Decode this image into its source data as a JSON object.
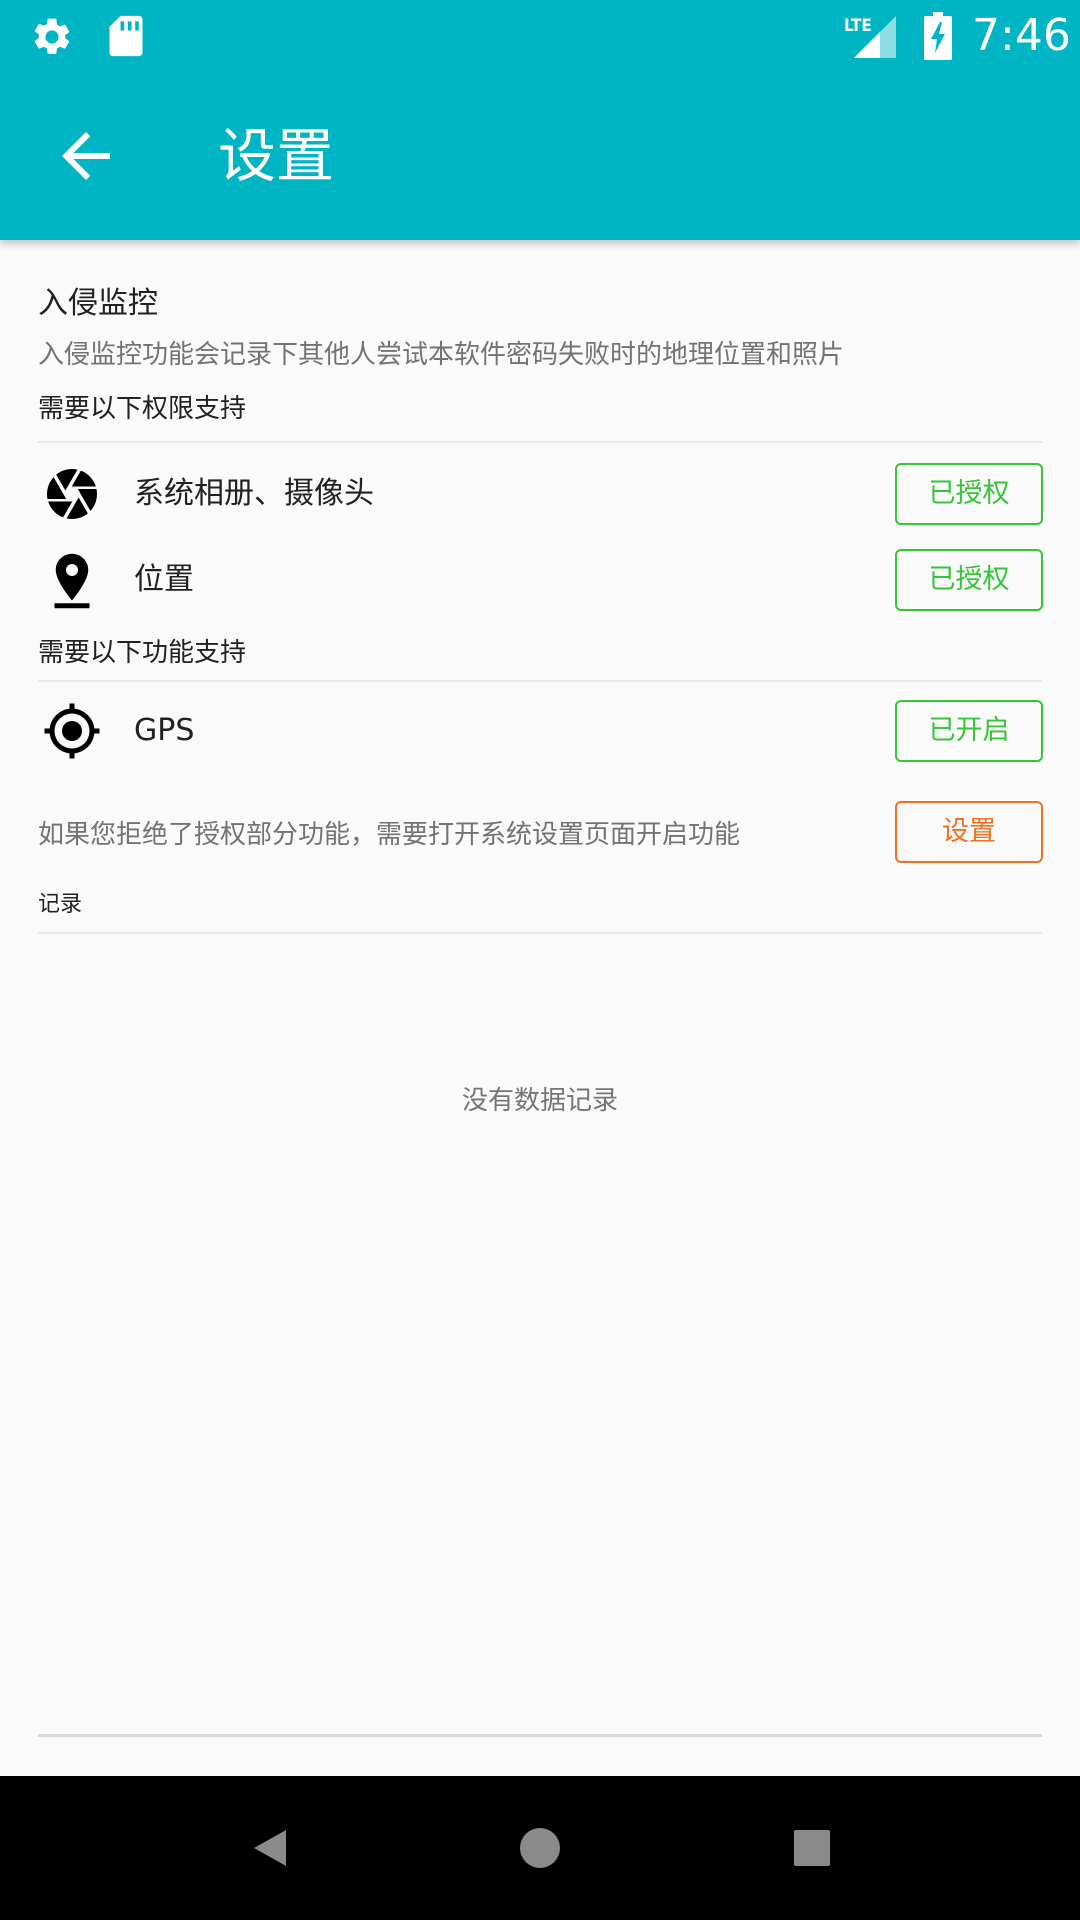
{
  "status_bar": {
    "time": "7:46",
    "network_label": "LTE",
    "icons": [
      "gear-icon",
      "sd-card-icon",
      "lte-signal-icon",
      "battery-charging-icon"
    ]
  },
  "app_bar": {
    "title": "设置",
    "back_icon": "arrow-left-icon",
    "color": "#00b5c3"
  },
  "intrusion": {
    "title": "入侵监控",
    "description": "入侵监控功能会记录下其他人尝试本软件密码失败时的地理位置和照片",
    "permissions_header": "需要以下权限支持",
    "permissions": [
      {
        "icon": "camera-aperture-icon",
        "label": "系统相册、摄像头",
        "status": "已授权"
      },
      {
        "icon": "location-pin-icon",
        "label": "位置",
        "status": "已授权"
      }
    ],
    "features_header": "需要以下功能支持",
    "features": [
      {
        "icon": "gps-crosshair-icon",
        "label": "GPS",
        "status": "已开启"
      }
    ],
    "hint": "如果您拒绝了授权部分功能，需要打开系统设置页面开启功能",
    "settings_button": "设置"
  },
  "records": {
    "label": "记录",
    "empty_text": "没有数据记录"
  },
  "colors": {
    "granted": "#35c635",
    "action": "#f2701f"
  },
  "nav_bar": {
    "icons": [
      "nav-back-icon",
      "nav-home-icon",
      "nav-recents-icon"
    ]
  }
}
